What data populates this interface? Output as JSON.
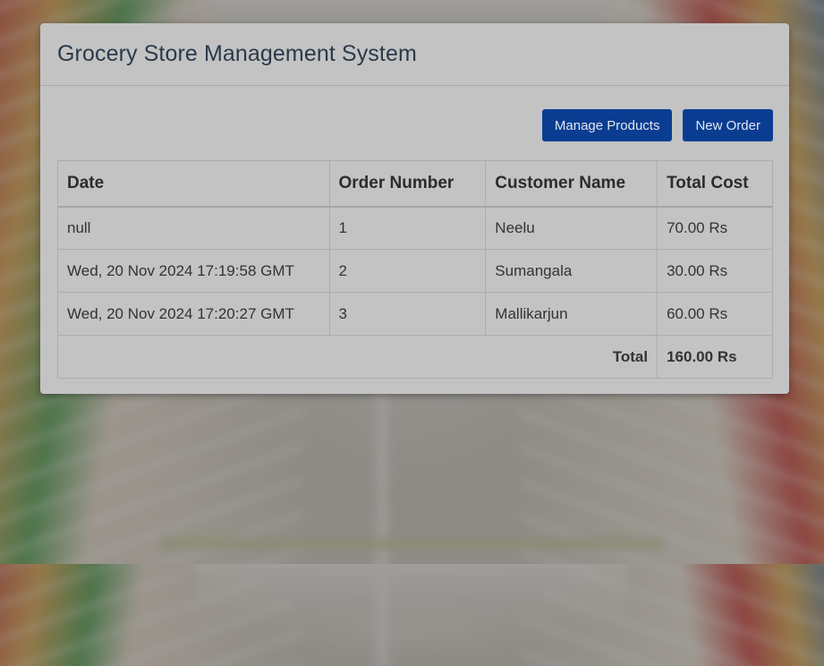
{
  "app": {
    "title": "Grocery Store Management System"
  },
  "toolbar": {
    "manage_products_label": "Manage Products",
    "new_order_label": "New Order",
    "button_color": "#0a3d91"
  },
  "orders_table": {
    "headers": {
      "date": "Date",
      "order_number": "Order Number",
      "customer_name": "Customer Name",
      "total_cost": "Total Cost"
    },
    "rows": [
      {
        "date": "null",
        "order_number": "1",
        "customer_name": "Neelu",
        "total_cost": "70.00 Rs"
      },
      {
        "date": "Wed, 20 Nov 2024 17:19:58 GMT",
        "order_number": "2",
        "customer_name": "Sumangala",
        "total_cost": "30.00 Rs"
      },
      {
        "date": "Wed, 20 Nov 2024 17:20:27 GMT",
        "order_number": "3",
        "customer_name": "Mallikarjun",
        "total_cost": "60.00 Rs"
      }
    ],
    "footer": {
      "total_label": "Total",
      "total_value": "160.00 Rs"
    }
  }
}
